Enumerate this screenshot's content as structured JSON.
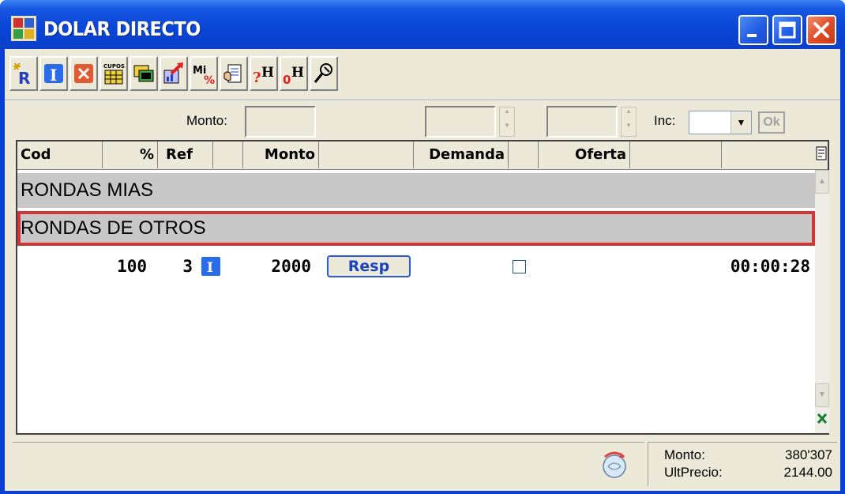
{
  "window": {
    "title": "DOLAR DIRECTO",
    "colors": {
      "titlebar": "#0a46d8",
      "close": "#e04a25",
      "client": "#ece9d8",
      "selection_border": "#d0353a"
    }
  },
  "toolbar": {
    "buttons": [
      {
        "icon": "new-round-icon"
      },
      {
        "icon": "info-icon"
      },
      {
        "icon": "delete-icon"
      },
      {
        "icon": "cupos-icon",
        "label": "CUPOS"
      },
      {
        "icon": "cards-icon"
      },
      {
        "icon": "chart-arrow-icon"
      },
      {
        "icon": "mi-percent-icon",
        "label": "Mi"
      },
      {
        "icon": "document-hand-icon"
      },
      {
        "icon": "question-h-icon",
        "label": "?H"
      },
      {
        "icon": "zero-h-icon",
        "label": "0H"
      },
      {
        "icon": "wrench-icon"
      }
    ]
  },
  "controls": {
    "monto_label": "Monto:",
    "monto_value": "",
    "inc_label": "Inc:",
    "inc_value": "",
    "ok_label": "Ok"
  },
  "table": {
    "columns": [
      "Cod",
      "%",
      "Ref",
      "",
      "Monto",
      "",
      "Demanda",
      "",
      "Oferta",
      ""
    ],
    "groups": [
      "RONDAS MIAS",
      "RONDAS DE OTROS"
    ],
    "row": {
      "pct": "100",
      "ref": "3",
      "monto": "2000",
      "resp_label": "Resp",
      "checked": false,
      "time": "00:00:28"
    }
  },
  "status": {
    "monto_label": "Monto:",
    "monto_value": "380'307",
    "ultprecio_label": "UltPrecio:",
    "ultprecio_value": "2144.00"
  }
}
